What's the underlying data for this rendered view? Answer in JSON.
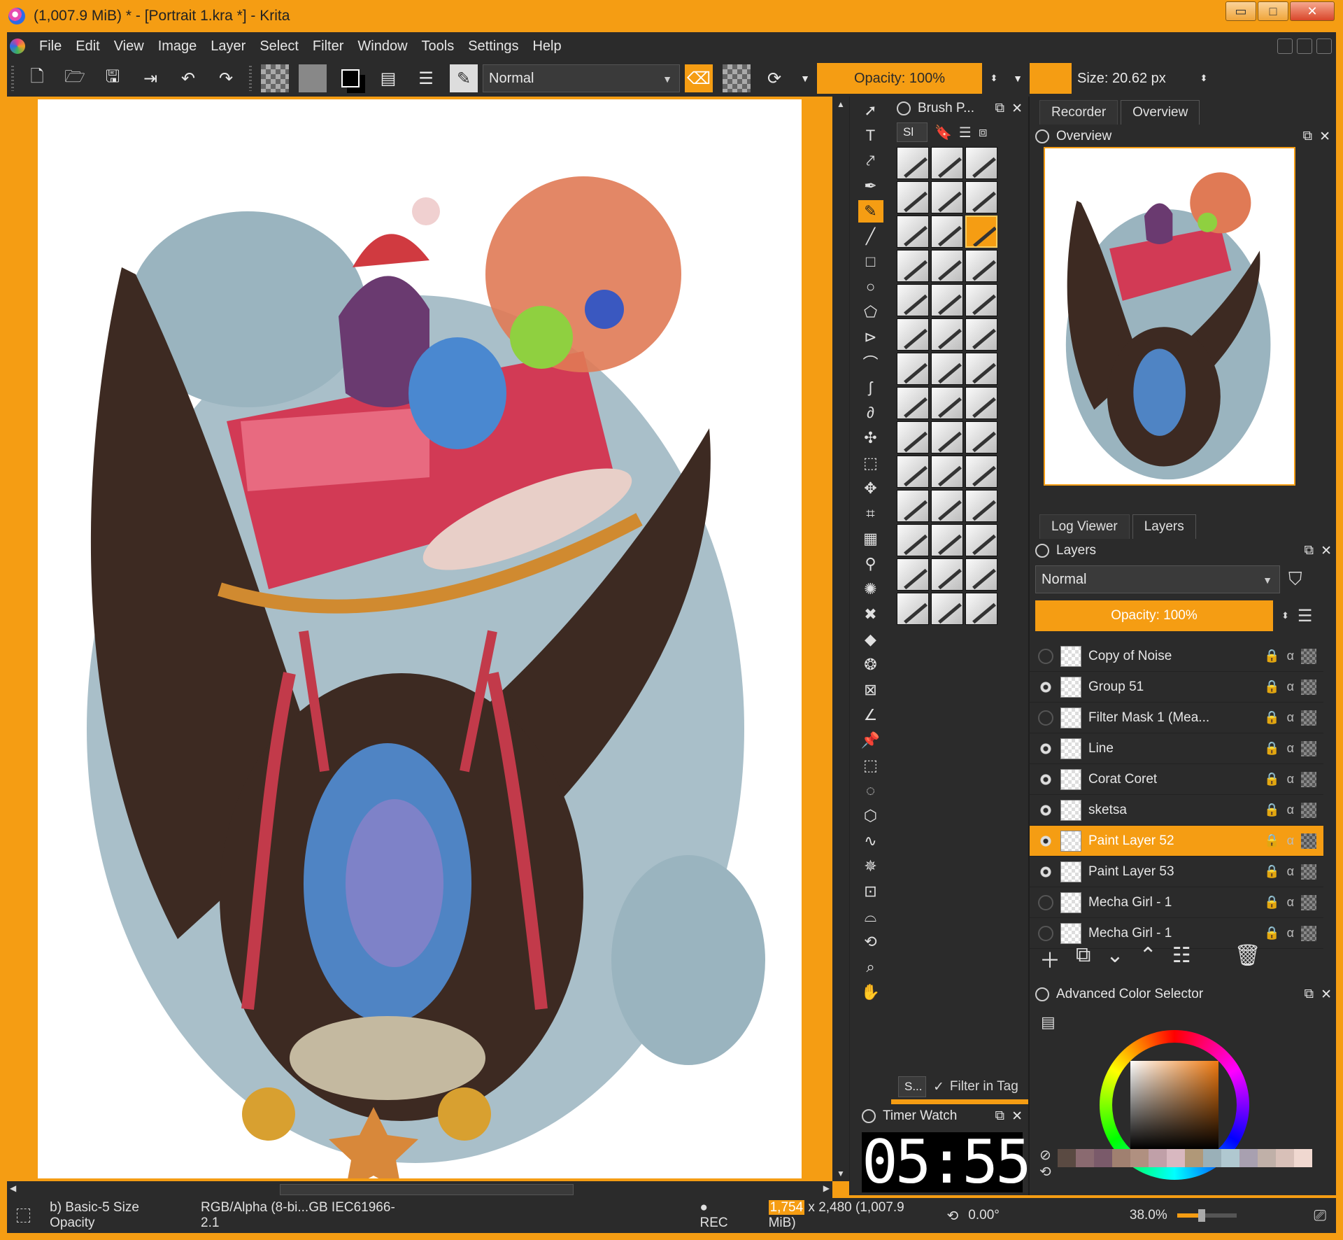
{
  "window": {
    "title": "(1,007.9 MiB)  * - [Portrait 1.kra *] - Krita",
    "minimize": "▭",
    "maximize": "□",
    "close": "✕"
  },
  "menu": [
    "File",
    "Edit",
    "View",
    "Image",
    "Layer",
    "Select",
    "Filter",
    "Window",
    "Tools",
    "Settings",
    "Help"
  ],
  "toolbar": {
    "blend_mode": "Normal",
    "opacity": "Opacity: 100%",
    "size": "Size: 20.62 px"
  },
  "brush_dock": {
    "title": "Brush P...",
    "tag_filter": "Sl",
    "search_placeholder": "S...",
    "filter_in_tag": "Filter in Tag",
    "filter_check": "✓"
  },
  "timer": {
    "title": "Timer Watch",
    "time": "05:55"
  },
  "top_tabs": [
    {
      "label": "Recorder",
      "active": false
    },
    {
      "label": "Overview",
      "active": true
    }
  ],
  "overview": {
    "title": "Overview"
  },
  "layer_tabs": [
    {
      "label": "Log Viewer",
      "active": false
    },
    {
      "label": "Layers",
      "active": true
    }
  ],
  "layers_panel": {
    "title": "Layers",
    "blend_mode": "Normal",
    "opacity": "Opacity:  100%"
  },
  "layers": [
    {
      "name": "Copy of Noise",
      "visible": false,
      "selected": false
    },
    {
      "name": "Group 51",
      "visible": true,
      "selected": false
    },
    {
      "name": "Filter Mask 1 (Mea...",
      "visible": false,
      "selected": false
    },
    {
      "name": "Line",
      "visible": true,
      "selected": false
    },
    {
      "name": "Corat Coret",
      "visible": true,
      "selected": false
    },
    {
      "name": "sketsa",
      "visible": true,
      "selected": false
    },
    {
      "name": "Paint Layer 52",
      "visible": true,
      "selected": true
    },
    {
      "name": "Paint Layer 53",
      "visible": true,
      "selected": false
    },
    {
      "name": "Mecha Girl - 1",
      "visible": false,
      "selected": false
    },
    {
      "name": "Mecha Girl - 1",
      "visible": false,
      "selected": false
    }
  ],
  "color_selector": {
    "title": "Advanced Color Selector"
  },
  "swatches": [
    "#5a4a42",
    "#8a6a70",
    "#7a5a6a",
    "#a08070",
    "#b09080",
    "#c0a0a8",
    "#d8b8c0",
    "#b09878",
    "#9ab0b8",
    "#b0c8d0",
    "#a8a0b0",
    "#c0b0a8",
    "#d8c0b8",
    "#f0d8d0"
  ],
  "colors": {
    "accent": "#f59d13",
    "panel": "#2b2b2b"
  },
  "status": {
    "brush": "b) Basic-5 Size Opacity",
    "colorspace": "RGB/Alpha (8-bi...GB IEC61966-2.1",
    "rec": "● REC",
    "dims_highlight": "1,754",
    "dims_rest": " x 2,480",
    "memory": "(1,007.9 MiB)",
    "rotation": "0.00°",
    "zoom": "38.0%"
  }
}
